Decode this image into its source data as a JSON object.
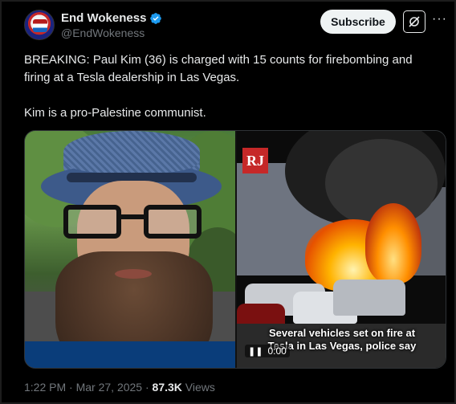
{
  "author": {
    "display_name": "End Wokeness",
    "handle": "@EndWokeness",
    "verified": true,
    "verified_color": "#1d9bf0"
  },
  "actions": {
    "subscribe_label": "Subscribe",
    "grok_icon": "grok-icon",
    "more_label": "···"
  },
  "tweet": {
    "paragraphs": [
      "BREAKING: Paul Kim (36) is charged with 15 counts for firebombing and firing at a Tesla dealership in Las Vegas.",
      "Kim is a pro-Palestine communist."
    ]
  },
  "media": {
    "video_logo": "RJ",
    "video_caption_line1": "Several vehicles set on fire at",
    "video_caption_line2": "Tesla in Las Vegas, police say",
    "video_time": "0:00",
    "pause_icon": "pause-icon"
  },
  "footer": {
    "time": "1:22 PM",
    "separator": "·",
    "date": "Mar 27, 2025",
    "views_count": "87.3K",
    "views_label": "Views"
  }
}
